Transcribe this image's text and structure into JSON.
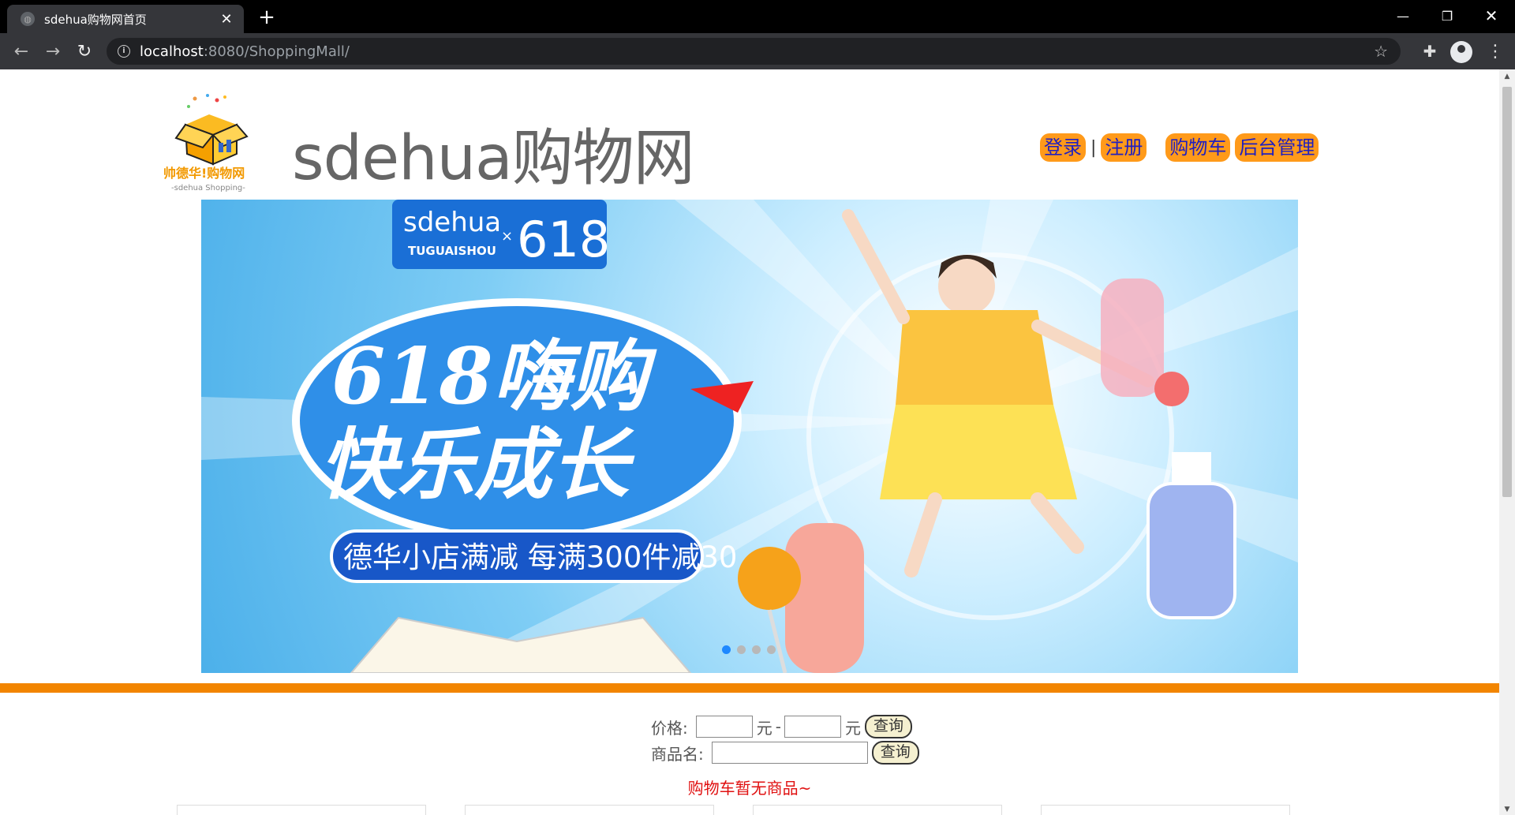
{
  "browser": {
    "tab_title": "sdehua购物网首页",
    "url_host": "localhost",
    "url_path": ":8080/ShoppingMall/"
  },
  "header": {
    "site_title": "sdehua购物网",
    "logo_brand": "帅德华!购物网",
    "logo_sub": "-sdehua Shopping-",
    "nav": [
      "登录",
      "注册",
      "购物车",
      "后台管理"
    ],
    "separator": "|"
  },
  "banner": {
    "badge_brand": "sdehua",
    "badge_sub": "TUGUAISHOU",
    "badge_x": "×",
    "badge_num": "618",
    "headline_1": "618嗨购",
    "headline_2": "快乐成长",
    "promo": "德华小店满减 每满300件减30",
    "slide_count": 4,
    "active_slide": 0
  },
  "search": {
    "price_label": "价格:",
    "yuan": "元",
    "dash": "-",
    "name_label": "商品名:",
    "query_button": "查询"
  },
  "cart": {
    "empty_message": "购物车暂无商品~"
  },
  "colors": {
    "accent_orange": "#f28500",
    "nav_bg": "#ff9a1a",
    "nav_text": "#2020c0",
    "empty_text": "#e01010"
  }
}
